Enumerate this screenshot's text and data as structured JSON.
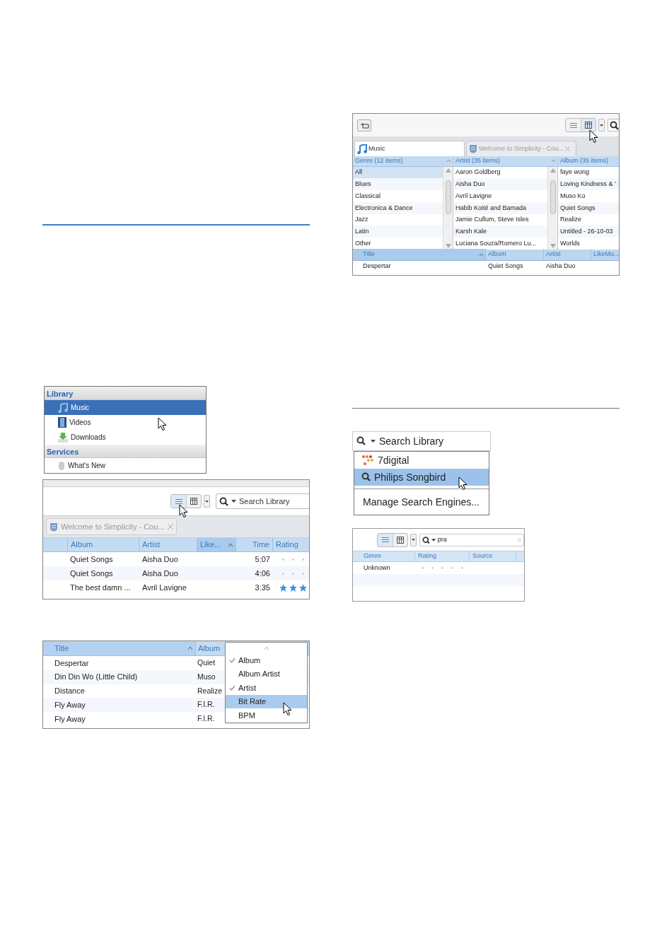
{
  "browser_view": {
    "tabs": [
      {
        "label": "Music",
        "selected": true,
        "kind": "music"
      },
      {
        "label": "Welcome to Simplicity - Cou...",
        "selected": false,
        "kind": "web"
      }
    ],
    "panes": [
      {
        "header": "Genre (12 items)",
        "items": [
          {
            "label": "All",
            "selected": true
          },
          {
            "label": "Blues",
            "selected": false
          },
          {
            "label": "Classical",
            "selected": false
          },
          {
            "label": "Electronica & Dance",
            "selected": false
          },
          {
            "label": "Jazz",
            "selected": false
          },
          {
            "label": "Latin",
            "selected": false
          },
          {
            "label": "Other",
            "selected": false
          }
        ]
      },
      {
        "header": "Artist (35 items)",
        "items": [
          {
            "label": "Aaron Goldberg",
            "selected": false
          },
          {
            "label": "Aisha Duo",
            "selected": false
          },
          {
            "label": "Avril Lavigne",
            "selected": false
          },
          {
            "label": "Habib Koité and Bamada",
            "selected": false
          },
          {
            "label": "Jamie Cullum, Steve Isles",
            "selected": false
          },
          {
            "label": "Karsh Kale",
            "selected": false
          },
          {
            "label": "Luciana Souza/Romero Lu...",
            "selected": false
          }
        ]
      },
      {
        "header": "Album (35 items)",
        "items": [
          {
            "label": "faye wong",
            "selected": false
          },
          {
            "label": "Loving Kindness & '",
            "selected": false
          },
          {
            "label": "Muso Ko",
            "selected": false
          },
          {
            "label": "Quiet Songs",
            "selected": false
          },
          {
            "label": "Realize",
            "selected": false
          },
          {
            "label": "Untitled - 26-10-03",
            "selected": false
          },
          {
            "label": "Worlds",
            "selected": false
          }
        ]
      }
    ],
    "track_columns": [
      "Title",
      "Album",
      "Artist",
      "LikeMu..."
    ],
    "track_rows": [
      [
        "Despertar",
        "Quiet Songs",
        "Aisha Duo",
        ""
      ]
    ]
  },
  "library_sidebar": {
    "groups": [
      {
        "title": "Library",
        "items": [
          {
            "label": "Music",
            "selected": true,
            "kind": "music"
          },
          {
            "label": "Videos",
            "selected": false,
            "kind": "video"
          },
          {
            "label": "Downloads",
            "selected": false,
            "kind": "download"
          }
        ]
      },
      {
        "title": "Services",
        "items": [
          {
            "label": "What's New",
            "selected": false,
            "kind": "service"
          }
        ]
      }
    ]
  },
  "list_view": {
    "search_placeholder": "Search Library",
    "tab": "Welcome to Simplicity - Cou...",
    "columns": [
      {
        "label": "Album",
        "sorted": false
      },
      {
        "label": "Artist",
        "sorted": false
      },
      {
        "label": "Like...",
        "sorted": true
      },
      {
        "label": "Time",
        "sorted": false
      },
      {
        "label": "Rating",
        "sorted": false
      }
    ],
    "rows": [
      {
        "album": "Quiet Songs",
        "artist": "Aisha Duo",
        "time": "5:07",
        "stars": 0
      },
      {
        "album": "Quiet Songs",
        "artist": "Aisha Duo",
        "time": "4:06",
        "stars": 0
      },
      {
        "album": "The best damn ...",
        "artist": "Avril Lavigne",
        "time": "3:35",
        "stars": 3
      }
    ]
  },
  "column_menu_view": {
    "columns": [
      "Title",
      "Album"
    ],
    "rows": [
      [
        "Despertar",
        "Quiet"
      ],
      [
        "Din Din Wo (Little Child)",
        "Muso"
      ],
      [
        "Distance",
        "Realize"
      ],
      [
        "Fly Away",
        "F.I.R."
      ],
      [
        "Fly Away",
        "F.I.R."
      ]
    ],
    "menu": [
      {
        "label": "Album",
        "checked": true,
        "selected": false
      },
      {
        "label": "Album Artist",
        "checked": false,
        "selected": false
      },
      {
        "label": "Artist",
        "checked": true,
        "selected": false
      },
      {
        "label": "Bit Rate",
        "checked": false,
        "selected": true
      },
      {
        "label": "BPM",
        "checked": false,
        "selected": false
      }
    ]
  },
  "search_menu": {
    "placeholder": "Search Library",
    "engines": [
      {
        "label": "7digital",
        "selected": false,
        "kind": "brand"
      },
      {
        "label": "Philips Songbird",
        "selected": true,
        "kind": "search"
      }
    ],
    "manage": "Manage Search Engines..."
  },
  "filtered_view": {
    "query": "pra",
    "columns": [
      "Genre",
      "Rating",
      "Source"
    ],
    "rows": [
      {
        "genre": "Unknown",
        "stars": 0
      }
    ]
  }
}
